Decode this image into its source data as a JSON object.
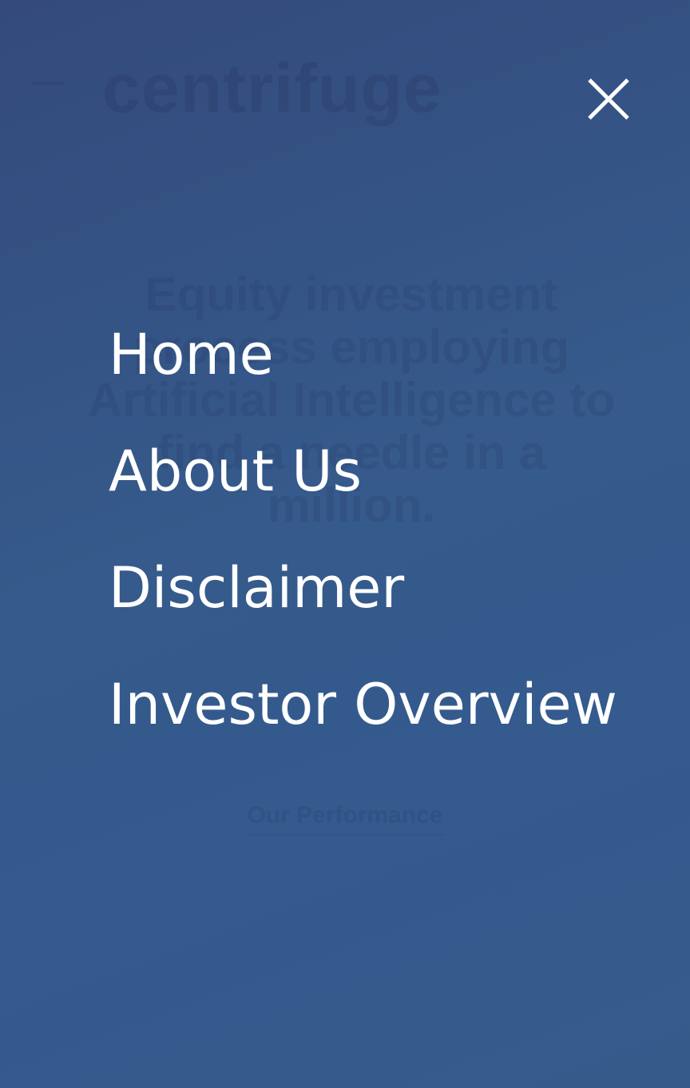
{
  "background": {
    "logo_text": "centrifuge",
    "headline": "Equity investment process employing Artificial Intelligence to find a needle in a million.",
    "cta_label": "Our Performance"
  },
  "nav": {
    "close_label": "Close menu",
    "items": [
      {
        "label": "Home"
      },
      {
        "label": "About Us"
      },
      {
        "label": "Disclaimer"
      },
      {
        "label": "Investor Overview"
      }
    ]
  },
  "colors": {
    "gradient_start": "#344a7c",
    "gradient_end": "#365b8b",
    "text": "#ffffff"
  }
}
